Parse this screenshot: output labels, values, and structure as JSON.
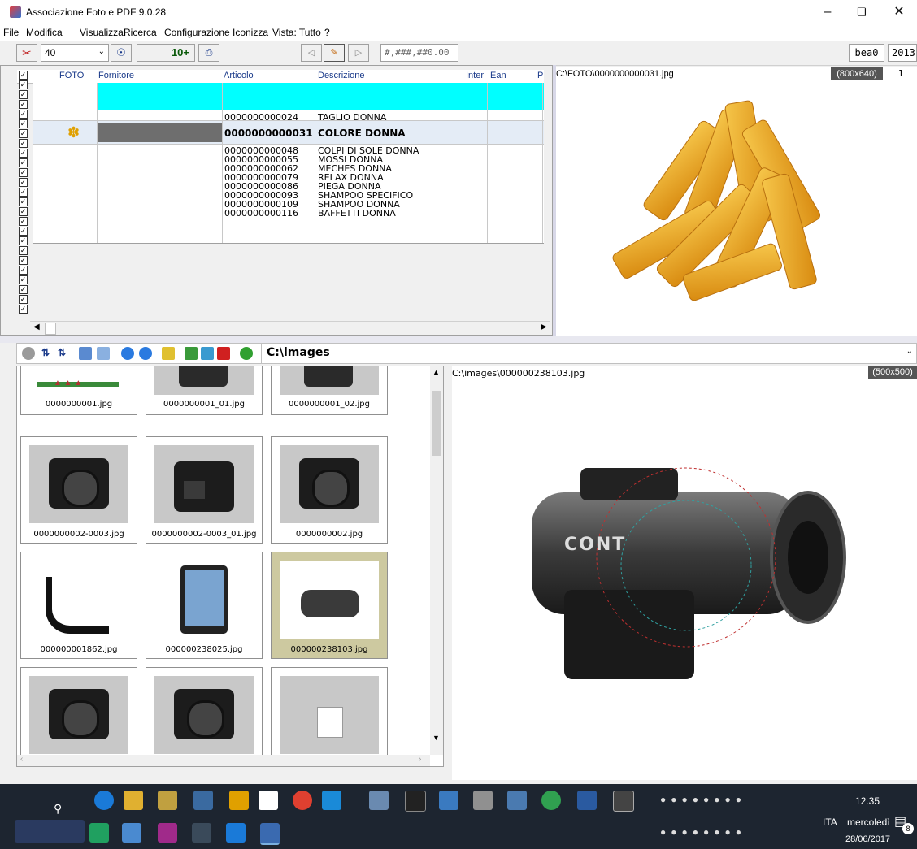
{
  "window": {
    "title": "Associazione Foto e PDF 9.0.28"
  },
  "menu": [
    "File",
    "Modifica",
    "Visualizza",
    "Ricerca",
    "Configurazione",
    "Iconizza",
    "Vista: Tutto",
    "?"
  ],
  "toolbar": {
    "count_value": "40",
    "counter_label": "10+",
    "number_format": "#,###,##0.00",
    "user": "bea0",
    "year": "2013"
  },
  "grid": {
    "headers": {
      "foto": "FOTO",
      "fornitore": "Fornitore",
      "articolo": "Articolo",
      "descrizione": "Descrizione",
      "inter": "Inter",
      "ean": "Ean",
      "p": "P"
    },
    "rows": [
      {
        "articolo": "0000000000024",
        "descrizione": "TAGLIO DONNA"
      },
      {
        "articolo": "0000000000031",
        "descrizione": "COLORE DONNA"
      },
      {
        "articolo": "0000000000048",
        "descrizione": "COLPI DI SOLE DONNA"
      },
      {
        "articolo": "0000000000055",
        "descrizione": "MOSSI DONNA"
      },
      {
        "articolo": "0000000000062",
        "descrizione": "MECHES DONNA"
      },
      {
        "articolo": "0000000000079",
        "descrizione": "RELAX DONNA"
      },
      {
        "articolo": "0000000000086",
        "descrizione": "PIEGA DONNA"
      },
      {
        "articolo": "0000000000093",
        "descrizione": "SHAMPOO SPECIFICO"
      },
      {
        "articolo": "0000000000109",
        "descrizione": "SHAMPOO DONNA"
      },
      {
        "articolo": "0000000000116",
        "descrizione": "BAFFETTI DONNA"
      }
    ]
  },
  "photo_top": {
    "path": "C:\\FOTO\\0000000000031.jpg",
    "size": "(800x640)",
    "page": "1"
  },
  "browser": {
    "folder": "C:\\images"
  },
  "thumbnails": [
    "0000000001.jpg",
    "0000000001_01.jpg",
    "0000000001_02.jpg",
    "0000000002-0003.jpg",
    "0000000002-0003_01.jpg",
    "0000000002.jpg",
    "000000001862.jpg",
    "000000238025.jpg",
    "000000238103.jpg"
  ],
  "preview": {
    "path": "C:\\images\\000000238103.jpg",
    "size": "(500x500)",
    "camera_text": "CONT"
  },
  "taskbar": {
    "lang": "ITA",
    "time": "12.35",
    "day": "mercoledì",
    "date": "28/06/2017",
    "notif_count": "8"
  }
}
